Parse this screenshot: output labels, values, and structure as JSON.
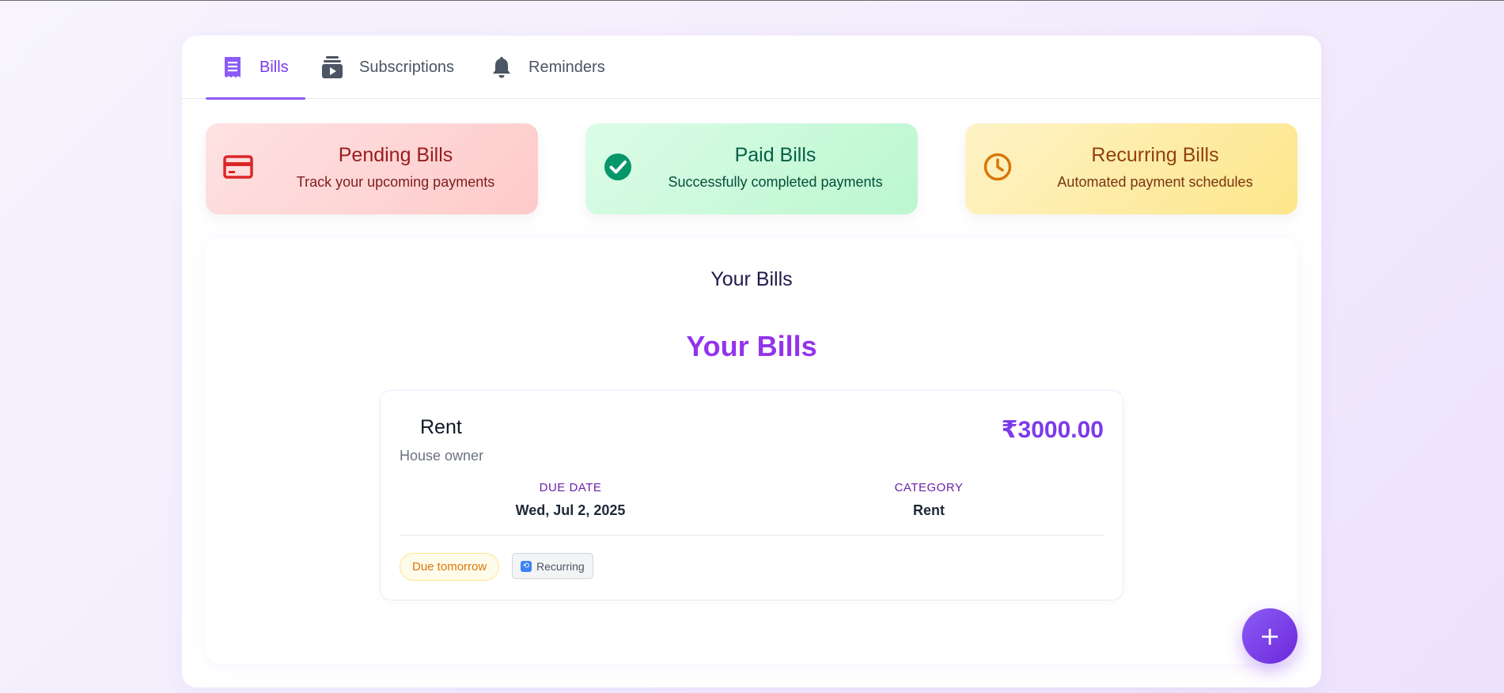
{
  "tabs": [
    {
      "label": "Bills",
      "icon": "receipt-icon",
      "active": true
    },
    {
      "label": "Subscriptions",
      "icon": "subscription-icon",
      "active": false
    },
    {
      "label": "Reminders",
      "icon": "bell-icon",
      "active": false
    }
  ],
  "summary_cards": {
    "pending": {
      "title": "Pending Bills",
      "subtitle": "Track your upcoming payments",
      "icon": "credit-card-icon",
      "color": "#dc2626"
    },
    "paid": {
      "title": "Paid Bills",
      "subtitle": "Successfully completed payments",
      "icon": "check-circle-icon",
      "color": "#059669"
    },
    "recurring": {
      "title": "Recurring Bills",
      "subtitle": "Automated payment schedules",
      "icon": "clock-icon",
      "color": "#d97706"
    }
  },
  "bills_section": {
    "heading": "Your Bills",
    "list_heading": "Your Bills",
    "bills": [
      {
        "name": "Rent",
        "payee": "House owner",
        "amount": "₹3000.00",
        "due_date_label": "DUE DATE",
        "due_date": "Wed, Jul 2, 2025",
        "category_label": "CATEGORY",
        "category": "Rent",
        "due_badge": "Due tomorrow",
        "recurring_badge": "Recurring",
        "recurring_glyph": "⟲"
      }
    ]
  },
  "fab": {
    "label": "+",
    "icon": "plus-icon"
  },
  "colors": {
    "accent": "#7c3aed",
    "accent_heading": "#9333ea",
    "warning": "#d97706"
  }
}
